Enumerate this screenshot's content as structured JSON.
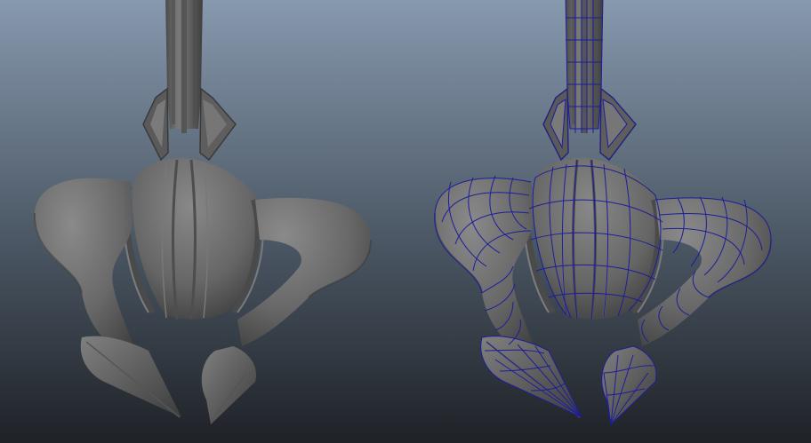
{
  "viewport": {
    "background_top": "#8799ae",
    "background_mid": "#4a5663",
    "background_bottom": "#1f2227"
  },
  "left_model": {
    "mode": "smooth-shaded",
    "body_color": "#6a6a6a",
    "highlight_color": "#8c8c8c",
    "shadow_color": "#3e3e3e"
  },
  "right_model": {
    "mode": "shaded-with-wireframe",
    "body_color": "#747474",
    "wire_color": "#1d1d9a"
  }
}
